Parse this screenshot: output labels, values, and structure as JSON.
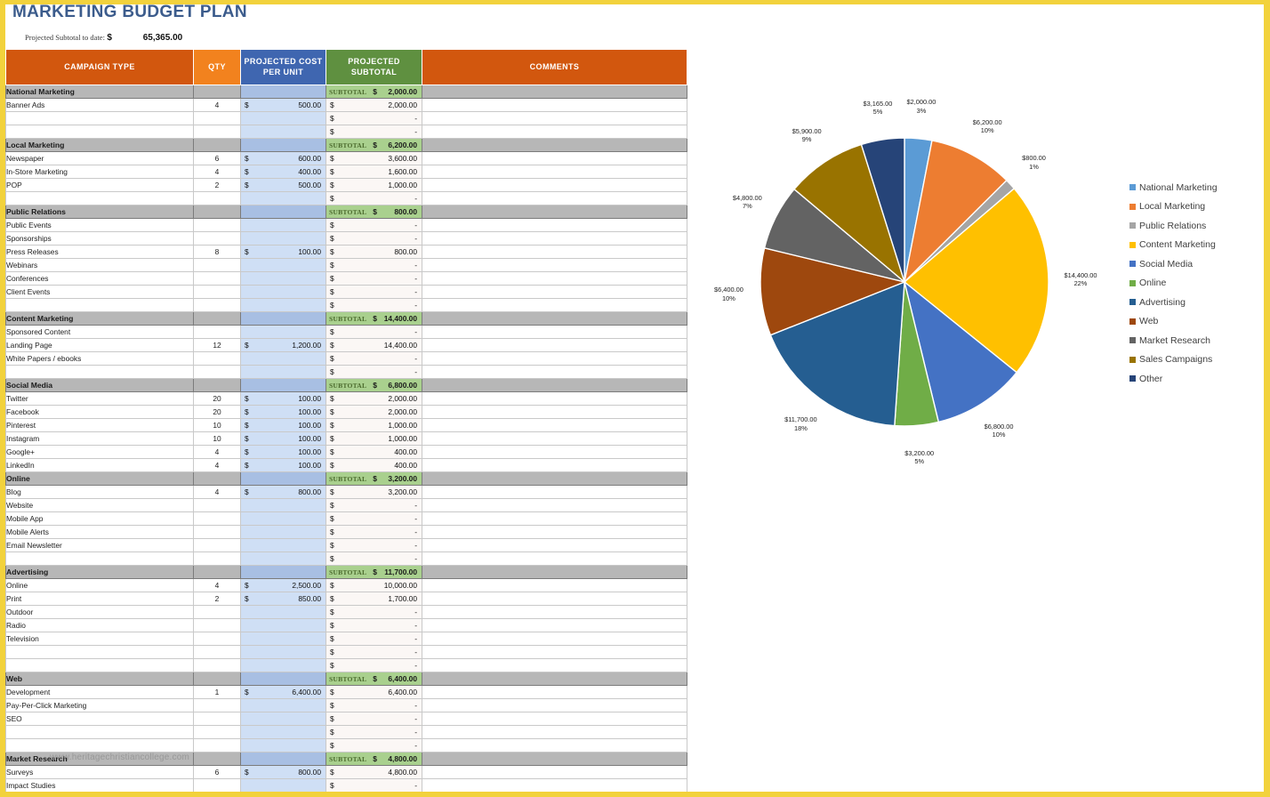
{
  "title": "MARKETING BUDGET PLAN",
  "summary": {
    "label": "Projected Subtotal to date:",
    "currency": "$",
    "amount": "65,365.00"
  },
  "watermark": "www.heritagechristiancollege.com",
  "table": {
    "headers": {
      "campaign_type": "CAMPAIGN TYPE",
      "qty": "QTY",
      "unit_cost": "PROJECTED COST PER UNIT",
      "subtotal": "PROJECTED SUBTOTAL",
      "comments": "COMMENTS"
    },
    "subtotal_word": "SUBTOTAL",
    "currency": "$",
    "dash": "-",
    "groups": [
      {
        "name": "National Marketing",
        "subtotal": "2,000.00",
        "rows": [
          {
            "name": "Banner Ads",
            "qty": "4",
            "unit": "500.00",
            "sub": "2,000.00"
          },
          {
            "name": "",
            "qty": "",
            "unit": "",
            "sub": "-"
          },
          {
            "name": "",
            "qty": "",
            "unit": "",
            "sub": "-"
          }
        ]
      },
      {
        "name": "Local Marketing",
        "subtotal": "6,200.00",
        "rows": [
          {
            "name": "Newspaper",
            "qty": "6",
            "unit": "600.00",
            "sub": "3,600.00"
          },
          {
            "name": "In-Store Marketing",
            "qty": "4",
            "unit": "400.00",
            "sub": "1,600.00"
          },
          {
            "name": "POP",
            "qty": "2",
            "unit": "500.00",
            "sub": "1,000.00"
          },
          {
            "name": "",
            "qty": "",
            "unit": "",
            "sub": "-"
          }
        ]
      },
      {
        "name": "Public Relations",
        "subtotal": "800.00",
        "rows": [
          {
            "name": "Public Events",
            "qty": "",
            "unit": "",
            "sub": "-"
          },
          {
            "name": "Sponsorships",
            "qty": "",
            "unit": "",
            "sub": "-"
          },
          {
            "name": "Press Releases",
            "qty": "8",
            "unit": "100.00",
            "sub": "800.00"
          },
          {
            "name": "Webinars",
            "qty": "",
            "unit": "",
            "sub": "-"
          },
          {
            "name": "Conferences",
            "qty": "",
            "unit": "",
            "sub": "-"
          },
          {
            "name": "Client Events",
            "qty": "",
            "unit": "",
            "sub": "-"
          },
          {
            "name": "",
            "qty": "",
            "unit": "",
            "sub": "-"
          }
        ]
      },
      {
        "name": "Content Marketing",
        "subtotal": "14,400.00",
        "rows": [
          {
            "name": "Sponsored Content",
            "qty": "",
            "unit": "",
            "sub": "-"
          },
          {
            "name": "Landing Page",
            "qty": "12",
            "unit": "1,200.00",
            "sub": "14,400.00"
          },
          {
            "name": "White Papers / ebooks",
            "qty": "",
            "unit": "",
            "sub": "-"
          },
          {
            "name": "",
            "qty": "",
            "unit": "",
            "sub": "-"
          }
        ]
      },
      {
        "name": "Social Media",
        "subtotal": "6,800.00",
        "rows": [
          {
            "name": "Twitter",
            "qty": "20",
            "unit": "100.00",
            "sub": "2,000.00"
          },
          {
            "name": "Facebook",
            "qty": "20",
            "unit": "100.00",
            "sub": "2,000.00"
          },
          {
            "name": "Pinterest",
            "qty": "10",
            "unit": "100.00",
            "sub": "1,000.00"
          },
          {
            "name": "Instagram",
            "qty": "10",
            "unit": "100.00",
            "sub": "1,000.00"
          },
          {
            "name": "Google+",
            "qty": "4",
            "unit": "100.00",
            "sub": "400.00"
          },
          {
            "name": "LinkedIn",
            "qty": "4",
            "unit": "100.00",
            "sub": "400.00"
          }
        ]
      },
      {
        "name": "Online",
        "subtotal": "3,200.00",
        "rows": [
          {
            "name": "Blog",
            "qty": "4",
            "unit": "800.00",
            "sub": "3,200.00"
          },
          {
            "name": "Website",
            "qty": "",
            "unit": "",
            "sub": "-"
          },
          {
            "name": "Mobile App",
            "qty": "",
            "unit": "",
            "sub": "-"
          },
          {
            "name": "Mobile Alerts",
            "qty": "",
            "unit": "",
            "sub": "-"
          },
          {
            "name": "Email Newsletter",
            "qty": "",
            "unit": "",
            "sub": "-"
          },
          {
            "name": "",
            "qty": "",
            "unit": "",
            "sub": "-"
          }
        ]
      },
      {
        "name": "Advertising",
        "subtotal": "11,700.00",
        "rows": [
          {
            "name": "Online",
            "qty": "4",
            "unit": "2,500.00",
            "sub": "10,000.00"
          },
          {
            "name": "Print",
            "qty": "2",
            "unit": "850.00",
            "sub": "1,700.00"
          },
          {
            "name": "Outdoor",
            "qty": "",
            "unit": "",
            "sub": "-"
          },
          {
            "name": "Radio",
            "qty": "",
            "unit": "",
            "sub": "-"
          },
          {
            "name": "Television",
            "qty": "",
            "unit": "",
            "sub": "-"
          },
          {
            "name": "",
            "qty": "",
            "unit": "",
            "sub": "-"
          },
          {
            "name": "",
            "qty": "",
            "unit": "",
            "sub": "-"
          }
        ]
      },
      {
        "name": "Web",
        "subtotal": "6,400.00",
        "rows": [
          {
            "name": "Development",
            "qty": "1",
            "unit": "6,400.00",
            "sub": "6,400.00"
          },
          {
            "name": "Pay-Per-Click Marketing",
            "qty": "",
            "unit": "",
            "sub": "-"
          },
          {
            "name": "SEO",
            "qty": "",
            "unit": "",
            "sub": "-"
          },
          {
            "name": "",
            "qty": "",
            "unit": "",
            "sub": "-"
          },
          {
            "name": "",
            "qty": "",
            "unit": "",
            "sub": "-"
          }
        ]
      },
      {
        "name": "Market Research",
        "subtotal": "4,800.00",
        "rows": [
          {
            "name": "Surveys",
            "qty": "6",
            "unit": "800.00",
            "sub": "4,800.00"
          },
          {
            "name": "Impact Studies",
            "qty": "",
            "unit": "",
            "sub": "-"
          }
        ]
      }
    ]
  },
  "chart_data": {
    "type": "pie",
    "title": "",
    "legend_position": "right",
    "value_prefix": "$",
    "categories": [
      "National Marketing",
      "Local Marketing",
      "Public Relations",
      "Content Marketing",
      "Social Media",
      "Online",
      "Advertising",
      "Web",
      "Market Research",
      "Sales Campaigns",
      "Other"
    ],
    "values": [
      2000,
      6200,
      800,
      14400,
      6800,
      3200,
      11700,
      6400,
      4800,
      5900,
      3165
    ],
    "value_labels": [
      "$2,000.00",
      "$6,200.00",
      "$800.00",
      "$14,400.00",
      "$6,800.00",
      "$3,200.00",
      "$11,700.00",
      "$6,400.00",
      "$4,800.00",
      "$5,900.00",
      "$3,165.00"
    ],
    "percent_labels": [
      "3%",
      "10%",
      "1%",
      "22%",
      "10%",
      "5%",
      "18%",
      "10%",
      "7%",
      "9%",
      "5%"
    ],
    "colors": [
      "#5b9bd5",
      "#ed7d31",
      "#a5a5a5",
      "#ffc000",
      "#4472c4",
      "#70ad47",
      "#255e91",
      "#9e480e",
      "#636363",
      "#997300",
      "#264478"
    ]
  }
}
